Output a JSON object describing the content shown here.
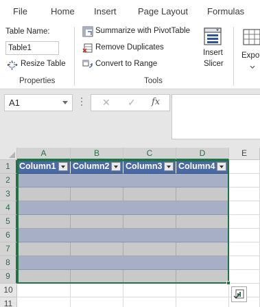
{
  "ribbon_tabs": [
    "File",
    "Home",
    "Insert",
    "Page Layout",
    "Formulas"
  ],
  "properties": {
    "table_name_label": "Table Name:",
    "table_name_value": "Table1",
    "resize_table": "Resize Table",
    "group_label": "Properties"
  },
  "tools": {
    "summarize_pivot": "Summarize with PivotTable",
    "remove_duplicates": "Remove Duplicates",
    "convert_to_range": "Convert to Range",
    "group_label": "Tools"
  },
  "insert_slicer": {
    "line1": "Insert",
    "line2": "Slicer"
  },
  "export": {
    "label": "Expor"
  },
  "formula_bar": {
    "name_box": "A1",
    "cancel_symbol": "✕",
    "enter_symbol": "✓",
    "fx_symbol": "fx",
    "formula": ""
  },
  "columns": [
    "A",
    "B",
    "C",
    "D",
    "E"
  ],
  "rows": [
    "1",
    "2",
    "3",
    "4",
    "5",
    "6",
    "7",
    "8",
    "9",
    "10",
    "11"
  ],
  "table": {
    "headers": [
      "Column1",
      "Column2",
      "Column3",
      "Column4"
    ],
    "data_rows": 8
  },
  "colors": {
    "excel_green": "#217346",
    "table_header": "#4a6aa6",
    "band_dark": "#a6afc6",
    "band_light": "#c9c9c9"
  }
}
